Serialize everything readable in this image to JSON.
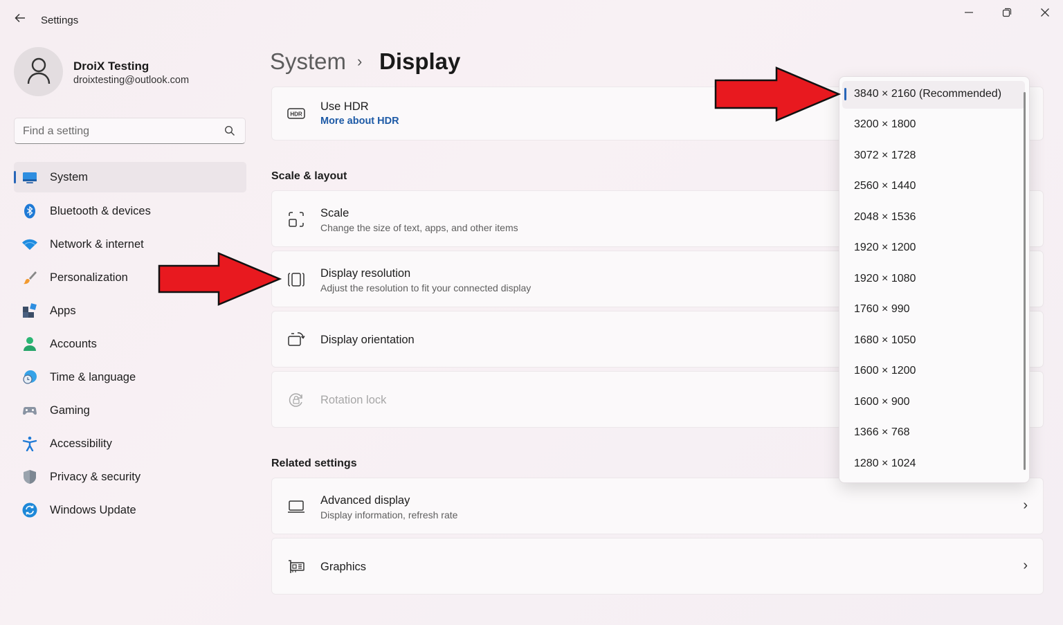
{
  "window": {
    "title": "Settings",
    "back_icon": "back-arrow-icon",
    "controls": {
      "minimize": "—",
      "maximize": "❐",
      "close": "✕"
    }
  },
  "user": {
    "name": "DroiX Testing",
    "email": "droixtesting@outlook.com"
  },
  "search": {
    "placeholder": "Find a setting"
  },
  "sidebar": {
    "items": [
      {
        "label": "System",
        "icon": "system-monitor-icon",
        "active": true
      },
      {
        "label": "Bluetooth & devices",
        "icon": "bluetooth-icon"
      },
      {
        "label": "Network & internet",
        "icon": "wifi-icon"
      },
      {
        "label": "Personalization",
        "icon": "paintbrush-icon"
      },
      {
        "label": "Apps",
        "icon": "apps-icon"
      },
      {
        "label": "Accounts",
        "icon": "person-icon"
      },
      {
        "label": "Time & language",
        "icon": "clock-globe-icon"
      },
      {
        "label": "Gaming",
        "icon": "gamepad-icon"
      },
      {
        "label": "Accessibility",
        "icon": "accessibility-icon"
      },
      {
        "label": "Privacy & security",
        "icon": "shield-icon"
      },
      {
        "label": "Windows Update",
        "icon": "update-icon"
      }
    ]
  },
  "breadcrumb": {
    "parent": "System",
    "separator": "›",
    "current": "Display"
  },
  "hdr": {
    "title": "Use HDR",
    "link": "More about HDR"
  },
  "scale_layout": {
    "heading": "Scale & layout",
    "scale": {
      "title": "Scale",
      "subtitle": "Change the size of text, apps, and other items"
    },
    "resolution": {
      "title": "Display resolution",
      "subtitle": "Adjust the resolution to fit your connected display"
    },
    "orientation": {
      "title": "Display orientation"
    },
    "rotation_lock": {
      "title": "Rotation lock"
    }
  },
  "related": {
    "heading": "Related settings",
    "advanced": {
      "title": "Advanced display",
      "subtitle": "Display information, refresh rate"
    },
    "graphics": {
      "title": "Graphics"
    }
  },
  "resolution_options": [
    {
      "label": "3840 × 2160 (Recommended)",
      "selected": true
    },
    {
      "label": "3200 × 1800"
    },
    {
      "label": "3072 × 1728"
    },
    {
      "label": "2560 × 1440"
    },
    {
      "label": "2048 × 1536"
    },
    {
      "label": "1920 × 1200"
    },
    {
      "label": "1920 × 1080"
    },
    {
      "label": "1760 × 990"
    },
    {
      "label": "1680 × 1050"
    },
    {
      "label": "1600 × 1200"
    },
    {
      "label": "1600 × 900"
    },
    {
      "label": "1366 × 768"
    },
    {
      "label": "1280 × 1024"
    }
  ],
  "colors": {
    "accent": "#2866b8",
    "annotation_arrow": "#e8191f"
  }
}
